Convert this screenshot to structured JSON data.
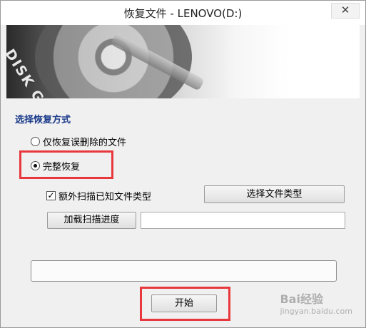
{
  "window": {
    "title": "恢复文件 - LENOVO(D:)",
    "close_label": "✕"
  },
  "banner": {
    "logo_text": "DISK GENIUS"
  },
  "recovery_mode": {
    "group_title": "选择恢复方式",
    "option_deleted": "仅恢复误删除的文件",
    "option_full": "完整恢复",
    "selected": "完整恢复"
  },
  "options": {
    "extra_scan_label": "额外扫描已知文件类型",
    "extra_scan_checked": true,
    "checkmark": "✓",
    "select_types_button": "选择文件类型",
    "load_progress_button": "加载扫描进度",
    "progress_path_value": ""
  },
  "progress": {
    "value": 0
  },
  "actions": {
    "start_button": "开始"
  },
  "watermark": {
    "text": "Bai经验",
    "sub": "jingyan.baidu.com"
  },
  "colors": {
    "highlight": "#e8383d",
    "group_title": "#1a3a8a"
  }
}
